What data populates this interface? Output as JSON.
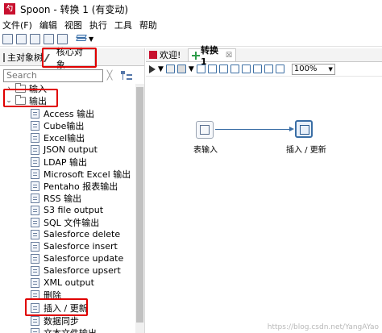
{
  "window": {
    "title": "Spoon - 转换 1 (有变动)",
    "app_icon_text": "勺"
  },
  "menubar": [
    "文件(F)",
    "编辑",
    "视图",
    "执行",
    "工具",
    "帮助"
  ],
  "left_panel": {
    "tabs": [
      {
        "label": "主对象树",
        "active": false
      },
      {
        "label": "核心对象",
        "active": true
      }
    ],
    "search": {
      "placeholder": "Search",
      "value": ""
    },
    "tree": [
      {
        "label": "输入",
        "type": "folder",
        "expanded": false
      },
      {
        "label": "输出",
        "type": "folder",
        "expanded": true
      },
      {
        "label": "Access 输出",
        "type": "step"
      },
      {
        "label": "Cube输出",
        "type": "step"
      },
      {
        "label": "Excel输出",
        "type": "step"
      },
      {
        "label": "JSON output",
        "type": "step"
      },
      {
        "label": "LDAP 输出",
        "type": "step"
      },
      {
        "label": "Microsoft Excel 输出",
        "type": "step"
      },
      {
        "label": "Pentaho 报表输出",
        "type": "step"
      },
      {
        "label": "RSS 输出",
        "type": "step"
      },
      {
        "label": "S3 file output",
        "type": "step"
      },
      {
        "label": "SQL 文件输出",
        "type": "step"
      },
      {
        "label": "Salesforce delete",
        "type": "step"
      },
      {
        "label": "Salesforce insert",
        "type": "step"
      },
      {
        "label": "Salesforce update",
        "type": "step"
      },
      {
        "label": "Salesforce upsert",
        "type": "step"
      },
      {
        "label": "XML output",
        "type": "step"
      },
      {
        "label": "删除",
        "type": "step"
      },
      {
        "label": "插入 / 更新",
        "type": "step"
      },
      {
        "label": "数据同步",
        "type": "step"
      },
      {
        "label": "文本文件输出",
        "type": "step"
      }
    ]
  },
  "right_panel": {
    "tabs": [
      {
        "label": "欢迎!",
        "active": false
      },
      {
        "label": "转换 1",
        "active": true,
        "close": "☒"
      }
    ],
    "zoom": "100%",
    "steps": [
      {
        "label": "表输入",
        "selected": false
      },
      {
        "label": "插入 / 更新",
        "selected": true
      }
    ],
    "watermark": "https://blog.csdn.net/YangAYao"
  },
  "colors": {
    "highlight_box": "#e00000",
    "accent": "#3a6ea5",
    "brand": "#c8102e"
  }
}
